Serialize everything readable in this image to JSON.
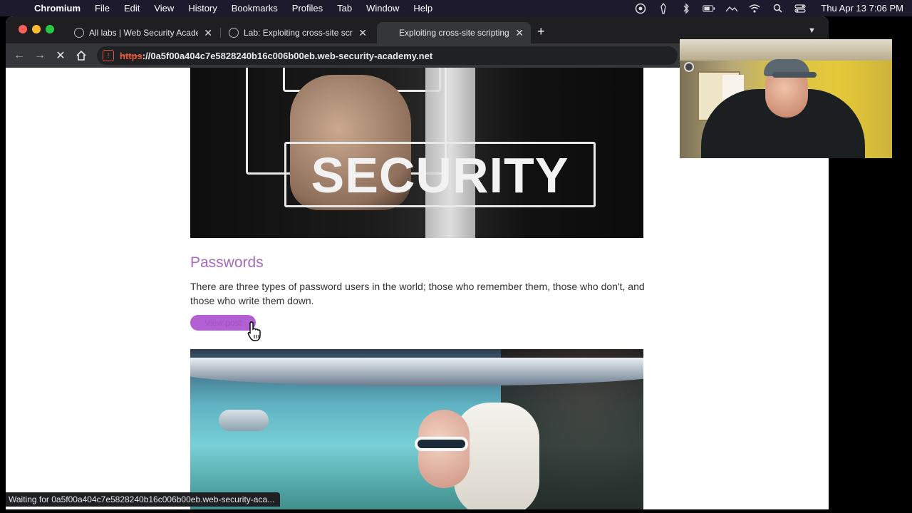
{
  "menubar": {
    "app_name": "Chromium",
    "items": [
      "File",
      "Edit",
      "View",
      "History",
      "Bookmarks",
      "Profiles",
      "Tab",
      "Window",
      "Help"
    ],
    "clock": "Thu Apr 13  7:06 PM",
    "status_icons": [
      "screen-record-icon",
      "pen-icon",
      "bluetooth-icon",
      "battery-icon",
      "spaces-icon",
      "wifi-icon",
      "spotlight-search-icon",
      "control-center-icon"
    ]
  },
  "tabs": [
    {
      "label": "All labs | Web Security Academ",
      "icon": "globe-icon"
    },
    {
      "label": "Lab: Exploiting cross-site scrip",
      "icon": "globe-icon"
    },
    {
      "label": "Exploiting cross-site scripting t",
      "icon": "loading-icon",
      "active": true
    }
  ],
  "toolbar": {
    "url_scheme": "https",
    "url_sep": "://",
    "url_host": "0a5f00a404c7e5828240b16c006b00eb.web-security-academy.net"
  },
  "page": {
    "security_image_text": "SECURITY",
    "post_title": "Passwords",
    "post_summary": "There are three types of password users in the world; those who remember them, those who don't, and those who write them down.",
    "view_post_label": "View post"
  },
  "statusbar": {
    "text": "Waiting for 0a5f00a404c7e5828240b16c006b00eb.web-security-aca..."
  },
  "colors": {
    "accent_purple": "#a869bf",
    "button_purple": "#b15fd2",
    "insecure_red": "#e0583a"
  }
}
